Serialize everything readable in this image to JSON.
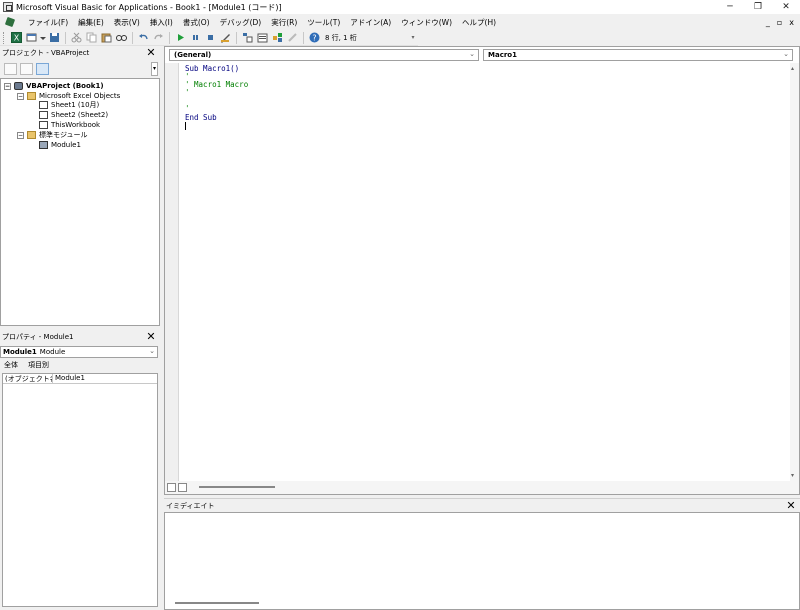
{
  "window": {
    "title": "Microsoft Visual Basic for Applications - Book1 - [Module1 (コード)]",
    "minimize": "─",
    "restore": "❐",
    "close": "✕"
  },
  "menubar": {
    "items": [
      "ファイル(F)",
      "編集(E)",
      "表示(V)",
      "挿入(I)",
      "書式(O)",
      "デバッグ(D)",
      "実行(R)",
      "ツール(T)",
      "アドイン(A)",
      "ウィンドウ(W)",
      "ヘルプ(H)"
    ],
    "mdi_min": "_",
    "mdi_restore": "▫",
    "mdi_close": "x"
  },
  "toolbar": {
    "cursor_position": "8 行, 1 桁"
  },
  "project_panel": {
    "title": "プロジェクト - VBAProject",
    "close": "✕",
    "tree": {
      "project": "VBAProject (Book1)",
      "excel_objects": "Microsoft Excel Objects",
      "sheet1": "Sheet1 (10月)",
      "sheet2": "Sheet2 (Sheet2)",
      "workbook": "ThisWorkbook",
      "modules": "標準モジュール",
      "module1": "Module1"
    }
  },
  "properties_panel": {
    "title": "プロパティ - Module1",
    "close": "✕",
    "object_name": "Module1",
    "object_type": "Module",
    "tab_all": "全体",
    "tab_category": "項目別",
    "rows": [
      {
        "key": "(オブジェクト名)",
        "value": "Module1"
      }
    ]
  },
  "code_window": {
    "object_combo": "(General)",
    "proc_combo": "Macro1",
    "lines": {
      "l1": "Sub Macro1()",
      "l2": "'",
      "l3": "' Macro1 Macro",
      "l4": "'",
      "l5": "",
      "l6": "'",
      "l7": "End Sub"
    }
  },
  "immediate": {
    "title": "イミディエイト",
    "close": "✕"
  }
}
